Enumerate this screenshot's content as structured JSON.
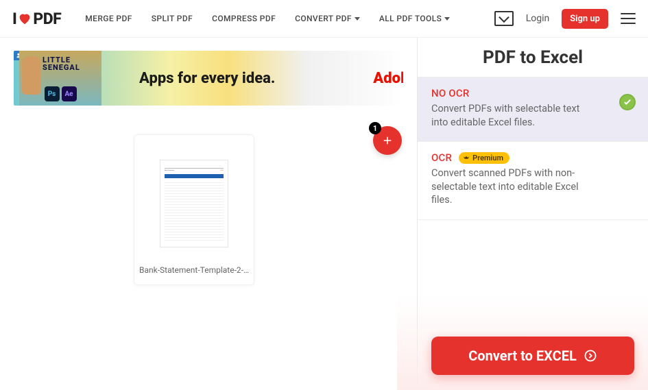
{
  "header": {
    "logo_prefix": "I",
    "logo_suffix": "PDF",
    "nav": [
      "MERGE PDF",
      "SPLIT PDF",
      "COMPRESS PDF",
      "CONVERT PDF",
      "ALL PDF TOOLS"
    ],
    "login": "Login",
    "signup": "Sign up"
  },
  "ad": {
    "tile_title": "LITTLE SENEGAL",
    "ps": "Ps",
    "ae": "Ae",
    "headline": "Apps for every idea.",
    "brand_partial": "Adol"
  },
  "files": {
    "count": "1",
    "card_name": "Bank-Statement-Template-2-Te..."
  },
  "sidebar": {
    "title": "PDF to Excel",
    "opt1_title": "NO OCR",
    "opt1_desc": "Convert PDFs with selectable text into editable Excel files.",
    "opt2_title": "OCR",
    "premium_label": "Premium",
    "opt2_desc": "Convert scanned PDFs with non-selectable text into editable Excel files.",
    "cta": "Convert to EXCEL"
  }
}
